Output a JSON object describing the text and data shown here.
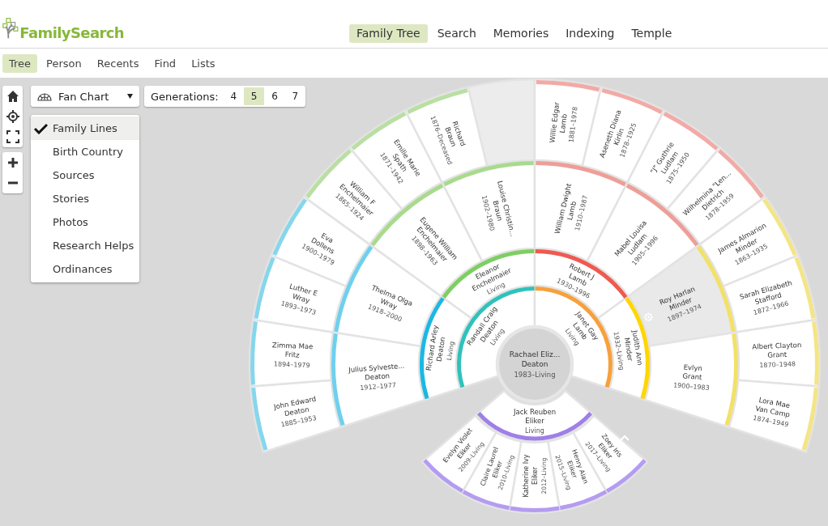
{
  "header": {
    "logo": "FamilySearch",
    "nav": [
      {
        "label": "Family Tree",
        "selected": true
      },
      {
        "label": "Search",
        "selected": false
      },
      {
        "label": "Memories",
        "selected": false
      },
      {
        "label": "Indexing",
        "selected": false
      },
      {
        "label": "Temple",
        "selected": false
      }
    ]
  },
  "subnav": [
    {
      "label": "Tree",
      "selected": true
    },
    {
      "label": "Person",
      "selected": false
    },
    {
      "label": "Recents",
      "selected": false
    },
    {
      "label": "Find",
      "selected": false
    },
    {
      "label": "Lists",
      "selected": false
    }
  ],
  "view_select": {
    "label": "Fan Chart"
  },
  "view_menu": [
    {
      "label": "Family Lines",
      "checked": true
    },
    {
      "label": "Birth Country",
      "checked": false
    },
    {
      "label": "Sources",
      "checked": false
    },
    {
      "label": "Stories",
      "checked": false
    },
    {
      "label": "Photos",
      "checked": false
    },
    {
      "label": "Research Helps",
      "checked": false
    },
    {
      "label": "Ordinances",
      "checked": false
    }
  ],
  "generations": {
    "label": "Generations:",
    "options": [
      {
        "label": "4",
        "selected": false
      },
      {
        "label": "5",
        "selected": true
      },
      {
        "label": "6",
        "selected": false
      },
      {
        "label": "7",
        "selected": false
      }
    ]
  },
  "fan": {
    "root": {
      "given": "Rachael Eliz...",
      "surname": "Deaton",
      "dates": "1983–Living"
    },
    "rings": [
      [
        {
          "kind": "person",
          "given": "Randall Craig",
          "surname": "Deaton",
          "dates": "Living",
          "color": "#2fc2bc"
        },
        {
          "kind": "person",
          "given": "Janet Gay",
          "surname": "Lamb",
          "dates": "Living",
          "color": "#f7a03c"
        }
      ],
      [
        {
          "kind": "person",
          "given": "Richard Arley",
          "surname": "Deaton",
          "dates": "Living",
          "color": "#1cb8e4"
        },
        {
          "kind": "person",
          "given": "Eleanor",
          "surname": "Enchelmaier",
          "dates": "Living",
          "color": "#7dcf62"
        },
        {
          "kind": "person",
          "given": "Robert J",
          "surname": "Lamb",
          "dates": "1930–1996",
          "color": "#ef5a50"
        },
        {
          "kind": "person",
          "given": "Judith Ann",
          "surname": "Minder",
          "dates": "1932–Living",
          "color": "#ffd600"
        }
      ],
      [
        {
          "kind": "person",
          "given": "Julius Sylveste...",
          "surname": "Deaton",
          "dates": "1912–1977",
          "color": "#6fd0ee",
          "highlighted": false
        },
        {
          "kind": "person",
          "given": "Thelma Olga",
          "surname": "Wray",
          "dates": "1918–2000",
          "color": "#6fd0ee",
          "highlighted": false
        },
        {
          "kind": "person",
          "given": "Eugene William",
          "surname": "Enchelmaier",
          "dates": "1898–1963",
          "color": "#a9da8e",
          "highlighted": false
        },
        {
          "kind": "person",
          "given": "Louise Christin...",
          "surname": "Braun",
          "dates": "1902–1980",
          "color": "#a9da8e",
          "highlighted": false
        },
        {
          "kind": "person",
          "given": "William Dwight",
          "surname": "Lamb",
          "dates": "1910–1987",
          "color": "#ee9e98",
          "highlighted": false
        },
        {
          "kind": "person",
          "given": "Mabel Louisa",
          "surname": "Ludlam",
          "dates": "1905–1996",
          "color": "#ee9e98",
          "highlighted": false
        },
        {
          "kind": "person",
          "given": "Roy Harlan",
          "surname": "Minder",
          "dates": "1897–1974",
          "color": "#f2e168",
          "highlighted": true
        },
        {
          "kind": "person",
          "given": "Evlyn",
          "surname": "Grant",
          "dates": "1900–1983",
          "color": "#f2e168",
          "highlighted": false
        }
      ],
      [
        {
          "kind": "person",
          "given": "John Edward",
          "surname": "Deaton",
          "dates": "1885–1953",
          "color": "#86d6ec"
        },
        {
          "kind": "person",
          "given": "Zimma Mae",
          "surname": "Fritz",
          "dates": "1894–1979",
          "color": "#86d6ec"
        },
        {
          "kind": "person",
          "given": "Luther E",
          "surname": "Wray",
          "dates": "1893–1973",
          "color": "#86d6ec"
        },
        {
          "kind": "person",
          "given": "Eva",
          "surname": "Dollens",
          "dates": "1900–1979",
          "color": "#86d6ec"
        },
        {
          "kind": "person",
          "given": "William F",
          "surname": "Enchelmaier",
          "dates": "1865–1924",
          "color": "#b9dfa2"
        },
        {
          "kind": "person",
          "given": "Emilie Marie",
          "surname": "Spath",
          "dates": "1871–1942",
          "color": "#b9dfa2"
        },
        {
          "kind": "person",
          "given": "Richard",
          "surname": "Braun",
          "dates": "1876–Deceased",
          "color": "#b9dfa2"
        },
        {
          "kind": "empty"
        },
        {
          "kind": "person",
          "given": "Willie Edgar",
          "surname": "Lamb",
          "dates": "1881–1978",
          "color": "#f2aaa6"
        },
        {
          "kind": "person",
          "given": "Aseneth Diana",
          "surname": "Kirlin",
          "dates": "1878–1925",
          "color": "#f2aaa6"
        },
        {
          "kind": "person",
          "given": "\"J\" Guthrie",
          "surname": "Ludlam",
          "dates": "1875–1950",
          "color": "#f2aaa6"
        },
        {
          "kind": "person",
          "given": "Wilhelmina \"Len...",
          "surname": "Dietrich",
          "dates": "1878–1959",
          "color": "#f2aaa6"
        },
        {
          "kind": "person",
          "given": "James Almarion",
          "surname": "Minder",
          "dates": "1863–1935",
          "color": "#f4e585"
        },
        {
          "kind": "person",
          "given": "Sarah Elizabeth",
          "surname": "Stafford",
          "dates": "1872–1966",
          "color": "#f4e585"
        },
        {
          "kind": "person",
          "given": "Albert Clayton",
          "surname": "Grant",
          "dates": "1870–1948",
          "color": "#f4e585"
        },
        {
          "kind": "person",
          "given": "Lora Mae",
          "surname": "Van Camp",
          "dates": "1874–1949",
          "color": "#f4e585"
        }
      ]
    ],
    "spouse": {
      "given": "Jack Reuben",
      "surname": "Eliker",
      "dates": "Living",
      "color": "#9f7fe8"
    },
    "children": [
      {
        "given": "Evelyn Violet",
        "surname": "Eliker",
        "dates": "2009–Living",
        "color": "#b49cf0"
      },
      {
        "given": "Claire Laurel",
        "surname": "Eliker",
        "dates": "2010–Living",
        "color": "#b49cf0"
      },
      {
        "given": "Katherine Ivy",
        "surname": "Eliker",
        "dates": "2012–Living",
        "color": "#b49cf0"
      },
      {
        "given": "Henry Alan",
        "surname": "Eliker",
        "dates": "2015–Living",
        "color": "#b49cf0"
      },
      {
        "given": "Zoey Iris",
        "surname": "Eliker",
        "dates": "2017–Living",
        "color": "#b49cf0"
      }
    ]
  }
}
